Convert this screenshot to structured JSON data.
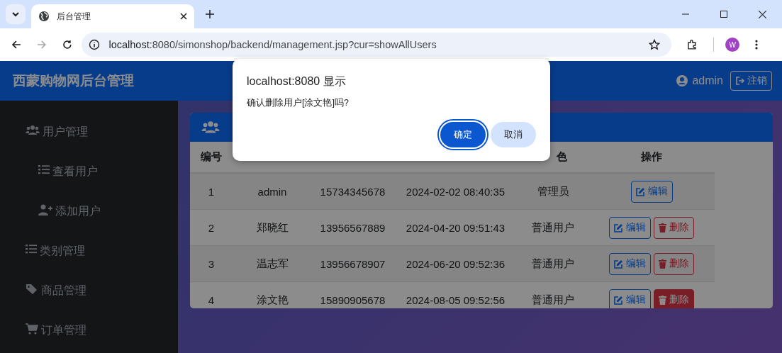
{
  "browser": {
    "tabs": [
      {
        "title": "后台管理",
        "selected": true
      }
    ],
    "url_host": "localhost",
    "url_rest": ":8080/simonshop/backend/management.jsp?cur=showAllUsers",
    "forward_disabled": true,
    "avatar": "W"
  },
  "header": {
    "title": "西蒙购物网后台管理",
    "user": "admin",
    "logout": "注销"
  },
  "sidebar": {
    "items": [
      {
        "label": "用户管理",
        "kind": "users",
        "children": [
          {
            "label": "查看用户",
            "kind": "list"
          },
          {
            "label": "添加用户",
            "kind": "user-plus"
          }
        ]
      },
      {
        "label": "类别管理",
        "kind": "list"
      },
      {
        "label": "商品管理",
        "kind": "tags"
      },
      {
        "label": "订单管理",
        "kind": "cart"
      }
    ]
  },
  "panel": {
    "table": {
      "columns": [
        "编号",
        null,
        null,
        null,
        "色",
        "操作"
      ],
      "rows": [
        {
          "cells": [
            "1",
            "admin",
            "15734345678",
            "2024-02-02 08:40:35",
            "管理员"
          ],
          "edit": "编辑"
        },
        {
          "cells": [
            "2",
            "郑晓红",
            "13956567889",
            "2024-04-20 09:51:43",
            "普通用户"
          ],
          "edit": "编辑",
          "delete": "删除",
          "delete_highlighted": false
        },
        {
          "cells": [
            "3",
            "温志军",
            "13956678907",
            "2024-06-20 09:52:36",
            "普通用户"
          ],
          "edit": "编辑",
          "delete": "删除",
          "delete_highlighted": false
        },
        {
          "cells": [
            "4",
            "涂文艳",
            "15890905678",
            "2024-08-05 09:52:56",
            "普通用户"
          ],
          "edit": "编辑",
          "delete": "删除",
          "delete_highlighted": true
        }
      ]
    }
  },
  "dialog": {
    "title": "localhost:8080 显示",
    "message": "确认删除用户[涂文艳]吗?",
    "buttons": [
      {
        "label": "确定",
        "selected": true
      },
      {
        "label": "取消",
        "selected": false
      }
    ]
  }
}
